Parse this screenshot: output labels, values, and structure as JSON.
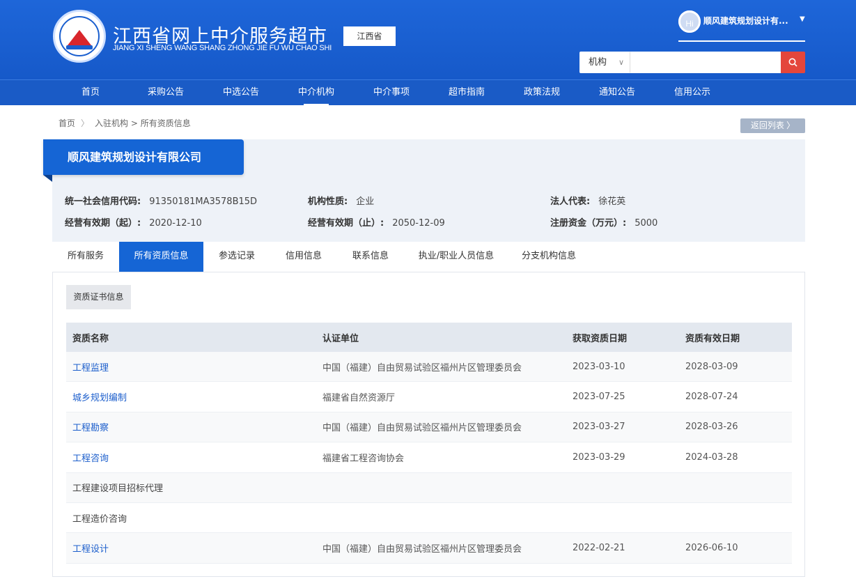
{
  "header": {
    "title": "江西省网上中介服务超市",
    "subtitle": "JIANG XI SHENG WANG SHANG ZHONG JIE FU WU CHAO SHI",
    "province": "江西省",
    "user": {
      "avatar_text": "Hi",
      "name": "顺风建筑规划设计有..."
    },
    "search": {
      "type_label": "机构",
      "placeholder": ""
    }
  },
  "nav": [
    "首页",
    "采购公告",
    "中选公告",
    "中介机构",
    "中介事项",
    "超市指南",
    "政策法规",
    "通知公告",
    "信用公示"
  ],
  "nav_active": "中介机构",
  "breadcrumb": {
    "home": "首页",
    "path": "入驻机构 > 所有资质信息"
  },
  "back_label": "返回列表",
  "company": {
    "name": "顺风建筑规划设计有限公司",
    "credit_code_label": "统一社会信用代码:",
    "credit_code": "91350181MA3578B15D",
    "nature_label": "机构性质:",
    "nature": "企业",
    "legal_rep_label": "法人代表:",
    "legal_rep": "徐花英",
    "valid_from_label": "经营有效期（起）:",
    "valid_from": "2020-12-10",
    "valid_to_label": "经营有效期（止）:",
    "valid_to": "2050-12-09",
    "capital_label": "注册资金（万元）:",
    "capital": "5000"
  },
  "tabs": [
    "所有服务",
    "所有资质信息",
    "参选记录",
    "信用信息",
    "联系信息",
    "执业/职业人员信息",
    "分支机构信息"
  ],
  "tab_active": "所有资质信息",
  "section_label": "资质证书信息",
  "table": {
    "headers": [
      "资质名称",
      "认证单位",
      "获取资质日期",
      "资质有效日期"
    ],
    "rows": [
      {
        "name": "工程监理",
        "unit": "中国（福建）自由贸易试验区福州片区管理委员会",
        "obtained": "2023-03-10",
        "valid": "2028-03-09"
      },
      {
        "name": "城乡规划编制",
        "unit": "福建省自然资源厅",
        "obtained": "2023-07-25",
        "valid": "2028-07-24"
      },
      {
        "name": "工程勘察",
        "unit": "中国（福建）自由贸易试验区福州片区管理委员会",
        "obtained": "2023-03-27",
        "valid": "2028-03-26"
      },
      {
        "name": "工程咨询",
        "unit": "福建省工程咨询协会",
        "obtained": "2023-03-29",
        "valid": "2024-03-28"
      },
      {
        "name": "工程建设项目招标代理",
        "unit": "",
        "obtained": "",
        "valid": ""
      },
      {
        "name": "工程造价咨询",
        "unit": "",
        "obtained": "",
        "valid": ""
      },
      {
        "name": "工程设计",
        "unit": "中国（福建）自由贸易试验区福州片区管理委员会",
        "obtained": "2022-02-21",
        "valid": "2026-06-10"
      }
    ]
  },
  "colors": {
    "primary": "#1565d5",
    "search_button": "#e4463b",
    "link": "#1d5fcc"
  }
}
